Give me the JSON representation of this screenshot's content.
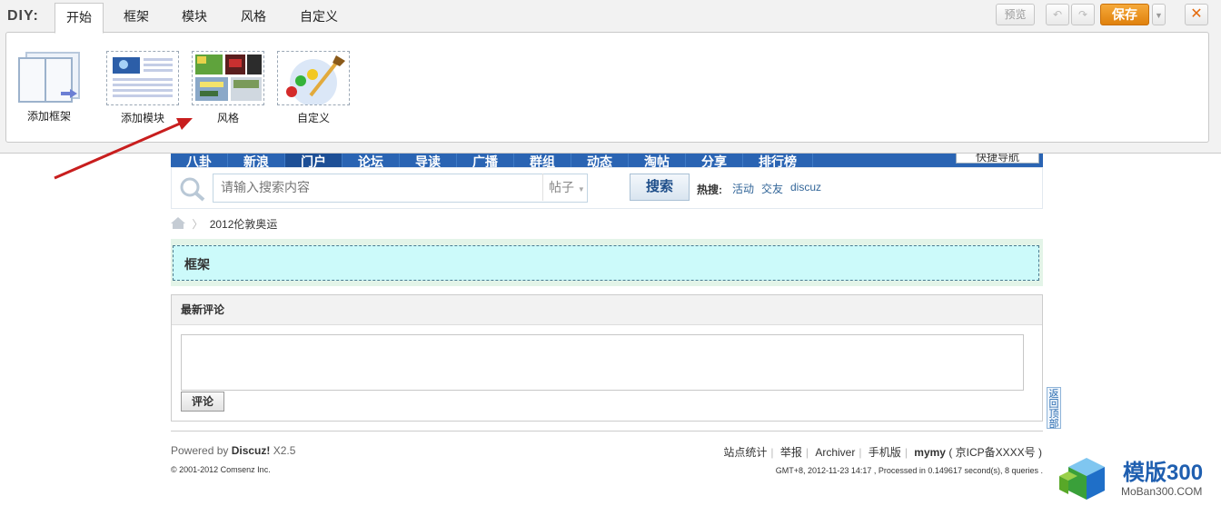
{
  "diy": {
    "label": "DIY:",
    "tabs": [
      "开始",
      "框架",
      "模块",
      "风格",
      "自定义"
    ],
    "tools": [
      {
        "label": "添加框架",
        "icon": "add-frame-icon"
      },
      {
        "label": "添加模块",
        "icon": "add-block-icon"
      },
      {
        "label": "风格",
        "icon": "style-icon"
      },
      {
        "label": "自定义",
        "icon": "custom-icon"
      }
    ],
    "preview": "预览",
    "save": "保存",
    "close": "✕"
  },
  "nav": {
    "items": [
      "八卦",
      "新浪",
      "门户",
      "论坛",
      "导读",
      "广播",
      "群组",
      "动态",
      "淘帖",
      "分享",
      "排行榜"
    ],
    "quick_nav": "快捷导航"
  },
  "search": {
    "placeholder": "请输入搜索内容",
    "type": "帖子",
    "button": "搜索",
    "hot_label": "热搜:",
    "hot_links": [
      "活动",
      "交友",
      "discuz"
    ]
  },
  "breadcrumb": {
    "current": "2012伦敦奥运"
  },
  "frame": {
    "label": "框架"
  },
  "comments": {
    "title": "最新评论",
    "submit": "评论"
  },
  "back_top": "返回顶部",
  "footer": {
    "powered_prefix": "Powered by ",
    "powered_brand": "Discuz!",
    "powered_version": " X2.5",
    "copyright": "© 2001-2012 Comsenz Inc.",
    "links": [
      "站点统计",
      "举报",
      "Archiver",
      "手机版"
    ],
    "site_user": "mymy",
    "icp": "( 京ICP备XXXX号 )",
    "debug": "GMT+8, 2012-11-23 14:17 , Processed in 0.149617 second(s), 8 queries ."
  },
  "watermark": {
    "text1": "模版300",
    "text2": "MoBan300.COM"
  },
  "colors": {
    "nav_blue": "#2a64b3",
    "save_orange": "#e88a14",
    "frame_cyan": "#ccfafa",
    "arrow_red": "#c81e1e"
  }
}
